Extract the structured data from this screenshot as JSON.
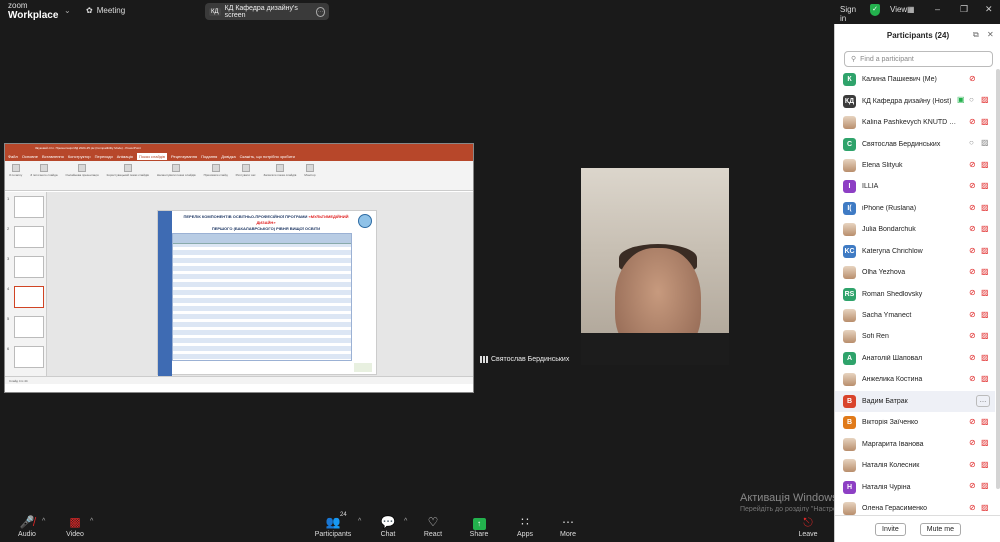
{
  "topbar": {
    "brand_line1": "zoom",
    "brand_line2": "Workplace",
    "meeting_label": "Meeting",
    "share_tag": "КД",
    "share_label": "КД Кафедра дизайну's screen",
    "sign_in": "Sign in",
    "view": "View"
  },
  "presentation": {
    "window_title": "Звуковий стіл. Презентація МД 2024-25 рік (Compatibility Mode) - PowerPoint",
    "tabs": [
      {
        "label": "Файл",
        "active": false
      },
      {
        "label": "Основне",
        "active": false
      },
      {
        "label": "Вставлення",
        "active": false
      },
      {
        "label": "Конструктор",
        "active": false
      },
      {
        "label": "Переходи",
        "active": false
      },
      {
        "label": "Анімація",
        "active": false
      },
      {
        "label": "Показ слайдів",
        "active": true
      },
      {
        "label": "Рецензування",
        "active": false
      },
      {
        "label": "Подання",
        "active": false
      },
      {
        "label": "Довідка",
        "active": false
      },
      {
        "label": "Скажіть, що потрібно зробити",
        "active": false
      }
    ],
    "ribbon_groups": [
      "З початку",
      "З поточного слайда",
      "Онлайнова презентація",
      "Користувацький показ слайдів",
      "Налаштувати показ слайдів",
      "Приховати слайд",
      "Рихтувати час",
      "Записати показ слайдів",
      "Монітор"
    ],
    "slide_title_1": "ПЕРЕЛІК КОМПОНЕНТІВ ОСВІТНЬО-ПРОФЕСІЙНОЇ ПРОГРАМИ",
    "slide_title_red": "«МУЛЬТИМЕДІЙНИЙ ДИЗАЙН»",
    "slide_title_2": "ПЕРШОГО (БАКАЛАВРСЬКОГО) РІВНЯ ВИЩОЇ ОСВІТИ",
    "slide_title_3": "ГАРАНТ ВАСИЛЬЄВА О.С., К.Т.Н., ДОЦЕНТ",
    "thumbnail_numbers": [
      "1",
      "2",
      "3",
      "4",
      "5",
      "6"
    ],
    "status_text": "Слайд 4 із 44"
  },
  "video": {
    "participant_name": "Святослав Бердинських"
  },
  "activation": {
    "title": "Активація Windows",
    "subtitle": "Перейдіть до розділу \"Настройки\", щоб активувати Windows."
  },
  "toolbar": {
    "audio": "Audio",
    "video": "Video",
    "participants": "Participants",
    "participants_count": "24",
    "chat": "Chat",
    "react": "React",
    "share": "Share",
    "apps": "Apps",
    "more": "More",
    "leave": "Leave"
  },
  "panel": {
    "title": "Participants (24)",
    "search_placeholder": "Find a participant",
    "invite": "Invite",
    "mute_me": "Mute me",
    "participants": [
      {
        "name": "Калина Пашкевич (Me)",
        "initial": "К",
        "color": "#2fa36b",
        "mic": "off",
        "cam": "none"
      },
      {
        "name": "КД Кафедра дизайну (Host)",
        "initial": "КД",
        "color": "#3c3c3c",
        "mic": "on",
        "cam": "off",
        "sharing": true
      },
      {
        "name": "Kalina Pashkevych KNUTD Ukraine",
        "initial": "",
        "color": "photo",
        "mic": "off",
        "cam": "off"
      },
      {
        "name": "Святослав Бердинських",
        "initial": "С",
        "color": "#2fa36b",
        "mic": "on",
        "cam": "on"
      },
      {
        "name": "Elena Slityuk",
        "initial": "",
        "color": "photo",
        "mic": "off",
        "cam": "off"
      },
      {
        "name": "ILLIA",
        "initial": "I",
        "color": "#8d3fc4",
        "mic": "off",
        "cam": "off"
      },
      {
        "name": "iPhone (Ruslana)",
        "initial": "I(",
        "color": "#3f7bc4",
        "mic": "off",
        "cam": "off"
      },
      {
        "name": "Julia Bondarchuk",
        "initial": "",
        "color": "photo",
        "mic": "off",
        "cam": "off"
      },
      {
        "name": "Kateryna Chrichlow",
        "initial": "KC",
        "color": "#3f7bc4",
        "mic": "off",
        "cam": "off"
      },
      {
        "name": "Olha Yezhova",
        "initial": "",
        "color": "photo",
        "mic": "off",
        "cam": "off"
      },
      {
        "name": "Roman Shedlovsky",
        "initial": "RS",
        "color": "#2fa36b",
        "mic": "off",
        "cam": "off"
      },
      {
        "name": "Sacha Ymanect",
        "initial": "",
        "color": "photo",
        "mic": "off",
        "cam": "off"
      },
      {
        "name": "Sofi Ren",
        "initial": "",
        "color": "photo",
        "mic": "off",
        "cam": "off"
      },
      {
        "name": "Анатолій Шаповал",
        "initial": "А",
        "color": "#2fa36b",
        "mic": "off",
        "cam": "off"
      },
      {
        "name": "Анжелика Костина",
        "initial": "",
        "color": "photo",
        "mic": "off",
        "cam": "off"
      },
      {
        "name": "Вадим Батрак",
        "initial": "В",
        "color": "#d9442c",
        "mic": "none",
        "cam": "none",
        "highlighted": true
      },
      {
        "name": "Вікторія Заїченко",
        "initial": "В",
        "color": "#e07a1a",
        "mic": "off",
        "cam": "off"
      },
      {
        "name": "Маргарита Іванова",
        "initial": "",
        "color": "photo",
        "mic": "off",
        "cam": "off"
      },
      {
        "name": "Наталія Колесник",
        "initial": "",
        "color": "photo",
        "mic": "off",
        "cam": "off"
      },
      {
        "name": "Наталія Чуріна",
        "initial": "Н",
        "color": "#8d3fc4",
        "mic": "off",
        "cam": "off"
      },
      {
        "name": "Олена Герасименко",
        "initial": "",
        "color": "photo",
        "mic": "off",
        "cam": "off"
      }
    ]
  }
}
